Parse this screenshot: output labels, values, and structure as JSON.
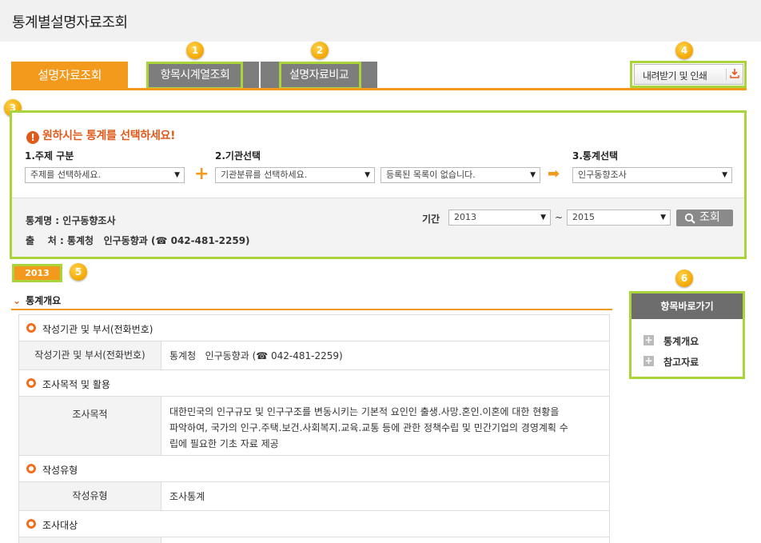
{
  "page": {
    "title": "통계별설명자료조회"
  },
  "tabs": [
    {
      "label": "설명자료조회",
      "active": true
    },
    {
      "label": "항목시계열조회",
      "active": false
    },
    {
      "label": "설명자료비교",
      "active": false
    }
  ],
  "badges": [
    "1",
    "2",
    "3",
    "4",
    "5",
    "6"
  ],
  "toolbar": {
    "download_label": "내려받기 및 인쇄",
    "download_icon": "download-icon"
  },
  "selection": {
    "alert": "원하시는 통계를 선택하세요!",
    "step1_label": "1.주제 구분",
    "step2_label": "2.기관선택",
    "step3_label": "3.통계선택",
    "subject_value": "주제를 선택하세요.",
    "org_category_value": "기관분류를 선택하세요.",
    "org_list_value": "등록된 목록이 없습니다.",
    "stat_value": "인구동향조사",
    "plus": "+",
    "arrow": "➡"
  },
  "info": {
    "stat_name": "통계명 : 인구동향조사",
    "source_label": "출    처 : ",
    "source_value": "통계청   인구동향과 (☎ 042-481-2259)",
    "period_label": "기간",
    "from_year": "2013",
    "tilde": "~",
    "to_year": "2015",
    "search_label": "조회"
  },
  "year_badge": "2013",
  "section": {
    "title": "통계개요",
    "groups": [
      {
        "title": "작성기관 및 부서(전화번호)",
        "rows": [
          {
            "label": "작성기관 및 부서(전화번호)",
            "value": "통계청   인구동향과 (☎ 042-481-2259)"
          }
        ]
      },
      {
        "title": "조사목적 및 활용",
        "rows": [
          {
            "label": "조사목적",
            "lines": [
              "대한민국의 인구규모 및 인구구조를 변동시키는 기본적 요인인 출생.사망.혼인.이혼에 대한 현황을",
              "파악하여, 국가의 인구.주택.보건.사회복지.교육.교통 등에 관한 정책수립 및 민간기업의 경영계획 수",
              "립에 필요한 기초 자료 제공"
            ]
          }
        ]
      },
      {
        "title": "작성유형",
        "rows": [
          {
            "label": "작성유형",
            "value": "조사통계"
          }
        ]
      },
      {
        "title": "조사대상",
        "rows": []
      }
    ]
  },
  "shortcut": {
    "title": "항목바로가기",
    "items": [
      "통계개요",
      "참고자료"
    ]
  },
  "colors": {
    "accent": "#f39a1c",
    "highlight": "#a9d53a",
    "alert": "#e05a1c",
    "tab_inactive": "#7d7d7d"
  }
}
